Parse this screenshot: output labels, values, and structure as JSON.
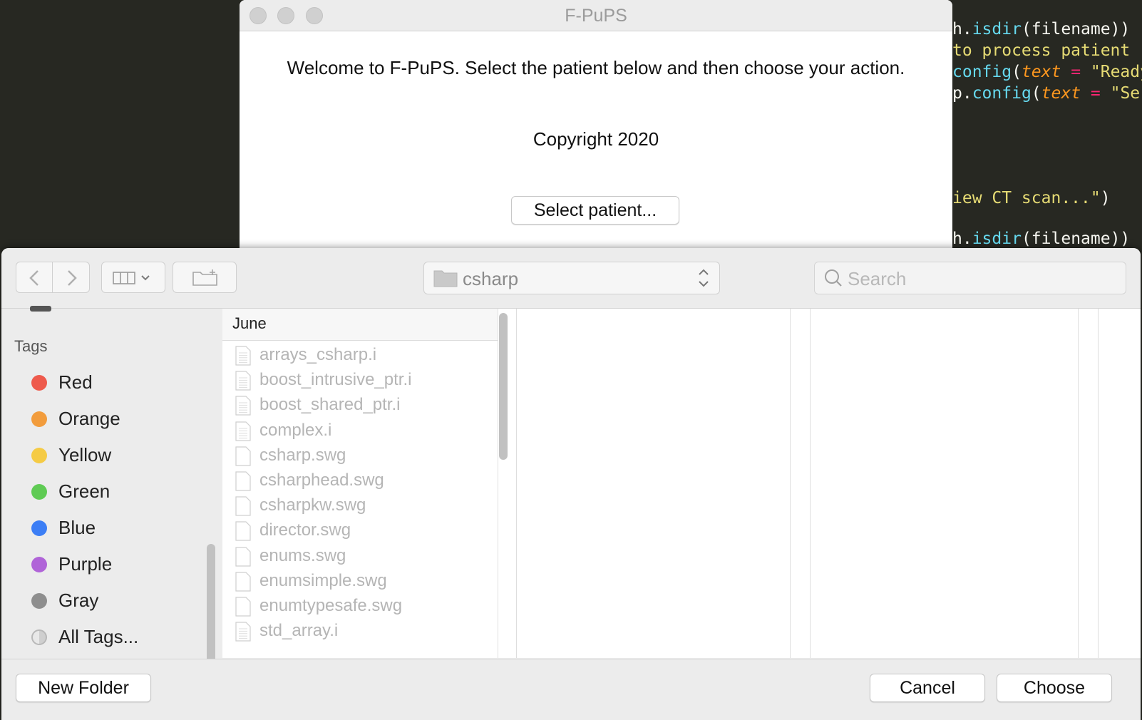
{
  "background_code": {
    "lines": [
      {
        "parts": [
          {
            "t": "h.",
            "c": "plain"
          },
          {
            "t": "isdir",
            "c": "fn"
          },
          {
            "t": "(filename))",
            "c": "plain"
          }
        ]
      },
      {
        "parts": [
          {
            "t": "to process patient ",
            "c": "str"
          }
        ]
      },
      {
        "parts": [
          {
            "t": "config",
            "c": "fn"
          },
          {
            "t": "(",
            "c": "plain"
          },
          {
            "t": "text",
            "c": "arg"
          },
          {
            "t": " = ",
            "c": "kw"
          },
          {
            "t": "\"Ready",
            "c": "str"
          }
        ]
      },
      {
        "parts": [
          {
            "t": "p.",
            "c": "plain"
          },
          {
            "t": "config",
            "c": "fn"
          },
          {
            "t": "(",
            "c": "plain"
          },
          {
            "t": "text",
            "c": "arg"
          },
          {
            "t": " = ",
            "c": "kw"
          },
          {
            "t": "\"Se",
            "c": "str"
          }
        ]
      },
      {
        "parts": [
          {
            "t": "iew CT scan...\"",
            "c": "str"
          },
          {
            "t": ")",
            "c": "plain"
          }
        ]
      },
      {
        "parts": [
          {
            "t": "h.",
            "c": "plain"
          },
          {
            "t": "isdir",
            "c": "fn"
          },
          {
            "t": "(filename))",
            "c": "plain"
          }
        ]
      }
    ]
  },
  "app_window": {
    "title": "F-PuPS",
    "welcome_text": "Welcome to F-PuPS. Select the patient below and then choose your action.",
    "copyright_text": "Copyright 2020",
    "select_button": "Select patient..."
  },
  "dialog": {
    "location": "csharp",
    "search_placeholder": "Search",
    "sidebar": {
      "tags_title": "Tags",
      "tags": [
        {
          "label": "Red",
          "color": "#ee5a4c"
        },
        {
          "label": "Orange",
          "color": "#f29c3c"
        },
        {
          "label": "Yellow",
          "color": "#f5cb45"
        },
        {
          "label": "Green",
          "color": "#5fcb54"
        },
        {
          "label": "Blue",
          "color": "#3c7ef5"
        },
        {
          "label": "Purple",
          "color": "#b064d8"
        },
        {
          "label": "Gray",
          "color": "#8e8e8e"
        },
        {
          "label": "All Tags...",
          "color": "all"
        }
      ]
    },
    "column": {
      "header": "June",
      "files": [
        {
          "name": "arrays_csharp.i",
          "icon": "text-file-icon"
        },
        {
          "name": "boost_intrusive_ptr.i",
          "icon": "text-file-icon"
        },
        {
          "name": "boost_shared_ptr.i",
          "icon": "text-file-icon"
        },
        {
          "name": "complex.i",
          "icon": "text-file-icon"
        },
        {
          "name": "csharp.swg",
          "icon": "blank-file-icon"
        },
        {
          "name": "csharphead.swg",
          "icon": "blank-file-icon"
        },
        {
          "name": "csharpkw.swg",
          "icon": "blank-file-icon"
        },
        {
          "name": "director.swg",
          "icon": "blank-file-icon"
        },
        {
          "name": "enums.swg",
          "icon": "blank-file-icon"
        },
        {
          "name": "enumsimple.swg",
          "icon": "blank-file-icon"
        },
        {
          "name": "enumtypesafe.swg",
          "icon": "blank-file-icon"
        },
        {
          "name": "std_array.i",
          "icon": "text-file-icon"
        }
      ]
    },
    "buttons": {
      "new_folder": "New Folder",
      "cancel": "Cancel",
      "choose": "Choose"
    }
  }
}
